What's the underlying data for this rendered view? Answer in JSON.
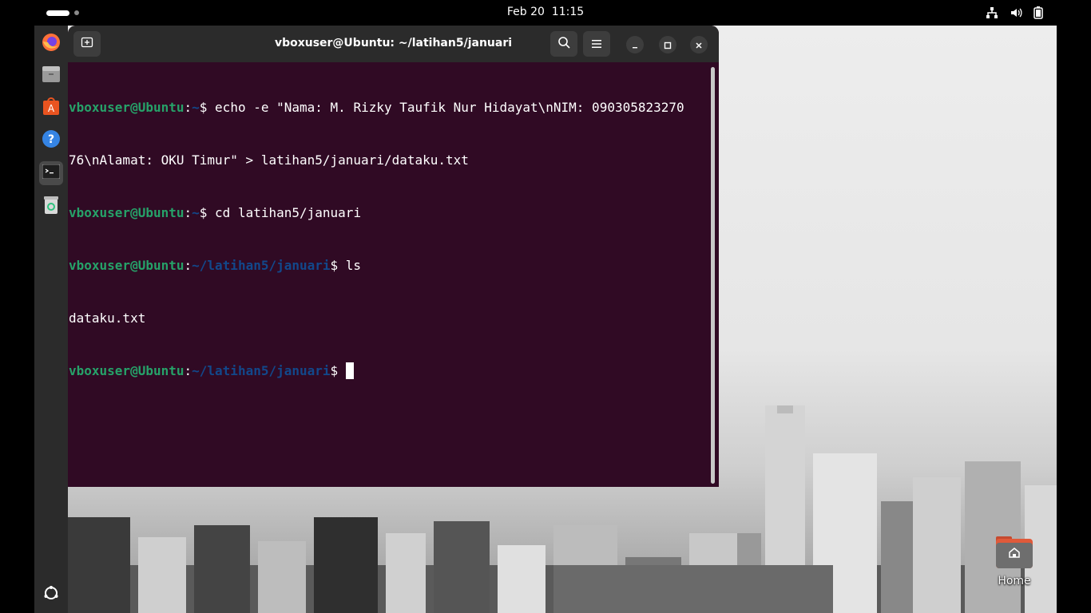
{
  "topbar": {
    "date": "Feb 20",
    "time": "11:15",
    "icons": [
      "network-icon",
      "volume-icon",
      "battery-icon"
    ]
  },
  "dock": {
    "items": [
      {
        "name": "firefox",
        "icon": "firefox-icon"
      },
      {
        "name": "files",
        "icon": "files-icon"
      },
      {
        "name": "app-center",
        "icon": "app-center-icon"
      },
      {
        "name": "help",
        "icon": "help-icon"
      },
      {
        "name": "terminal",
        "icon": "terminal-icon",
        "active": true
      },
      {
        "name": "trash",
        "icon": "trash-icon"
      }
    ],
    "bottom_icon": "show-apps-icon"
  },
  "terminal": {
    "title": "vboxuser@Ubuntu: ~/latihan5/januari",
    "lines": [
      {
        "user": "vboxuser@Ubuntu",
        "sep": ":",
        "path": "~",
        "prompt": "$ ",
        "text": "echo -e \"Nama: M. Rizky Taufik Nur Hidayat\\nNIM: 090305823270"
      },
      {
        "user": "",
        "sep": "",
        "path": "",
        "prompt": "",
        "text": "76\\nAlamat: OKU Timur\" > latihan5/januari/dataku.txt"
      },
      {
        "user": "vboxuser@Ubuntu",
        "sep": ":",
        "path": "~",
        "prompt": "$ ",
        "text": "cd latihan5/januari"
      },
      {
        "user": "vboxuser@Ubuntu",
        "sep": ":",
        "path": "~/latihan5/januari",
        "prompt": "$ ",
        "text": "ls"
      },
      {
        "user": "",
        "sep": "",
        "path": "",
        "prompt": "",
        "text": "dataku.txt"
      },
      {
        "user": "vboxuser@Ubuntu",
        "sep": ":",
        "path": "~/latihan5/januari",
        "prompt": "$ ",
        "text": ""
      }
    ]
  },
  "desktop": {
    "home_label": "Home"
  },
  "colors": {
    "terminal_bg": "#300a24",
    "prompt_user": "#26a269",
    "prompt_path": "#12488b",
    "header_bg": "#2b2b2b"
  }
}
